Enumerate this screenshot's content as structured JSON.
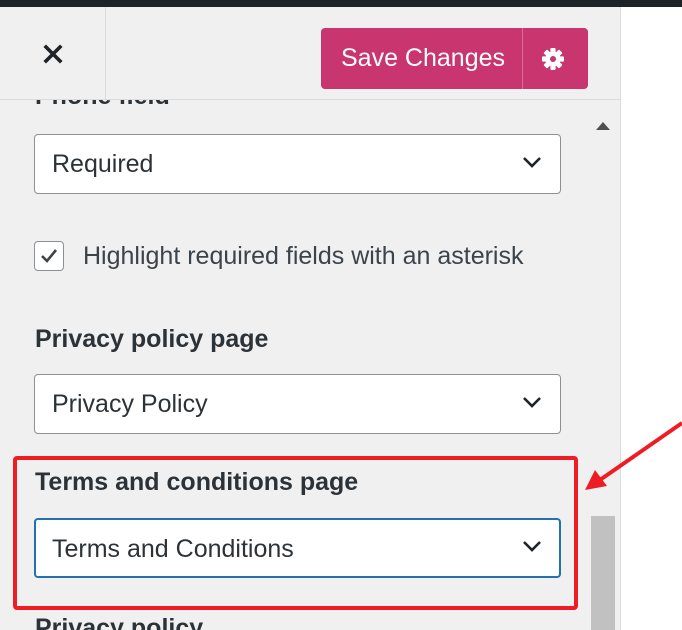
{
  "header": {
    "close_icon": "close-icon",
    "save_label": "Save Changes",
    "settings_icon": "gear-icon"
  },
  "form": {
    "cutoff_section_label": "Phone field",
    "phone_field_value": "Required",
    "asterisk_checkbox": {
      "label": "Highlight required fields with an asterisk",
      "checked": true
    },
    "privacy_page": {
      "label": "Privacy policy page",
      "value": "Privacy Policy"
    },
    "terms_page": {
      "label": "Terms and conditions page",
      "value": "Terms and Conditions"
    },
    "next_section_label": "Privacy policy"
  },
  "colors": {
    "accent": "#c9356e",
    "highlight": "#ee1d23",
    "focus": "#2271b1"
  }
}
